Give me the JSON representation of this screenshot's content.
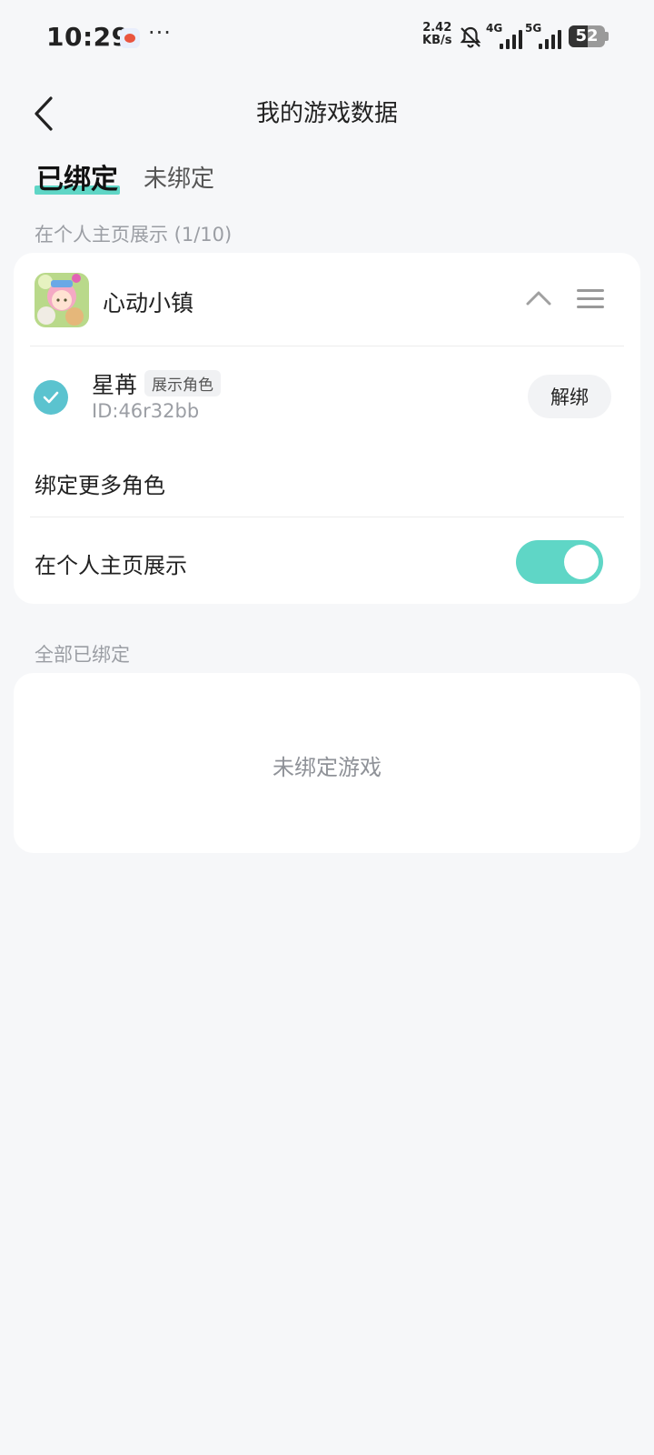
{
  "status_bar": {
    "time": "10:29",
    "more": "···",
    "net_speed_value": "2.42",
    "net_speed_unit": "KB/s",
    "signal_1_label": "4G",
    "signal_2_label": "5G",
    "battery_level": "52"
  },
  "header": {
    "title": "我的游戏数据",
    "back_icon": "chevron-left-icon"
  },
  "tabs": {
    "bound": "已绑定",
    "unbound": "未绑定",
    "active": "bound",
    "accent_color": "#5fd6c6"
  },
  "profile_section": {
    "label": "在个人主页展示 (1/10)",
    "game": {
      "name": "心动小镇",
      "icon": "game-app-icon"
    },
    "role": {
      "name": "星苒",
      "badge": "展示角色",
      "id": "ID:46r32bb",
      "unbind_label": "解绑",
      "checked": true
    },
    "bind_more_label": "绑定更多角色",
    "show_on_profile_label": "在个人主页展示",
    "show_on_profile_enabled": true
  },
  "all_bound_section": {
    "label": "全部已绑定",
    "empty_text": "未绑定游戏"
  }
}
